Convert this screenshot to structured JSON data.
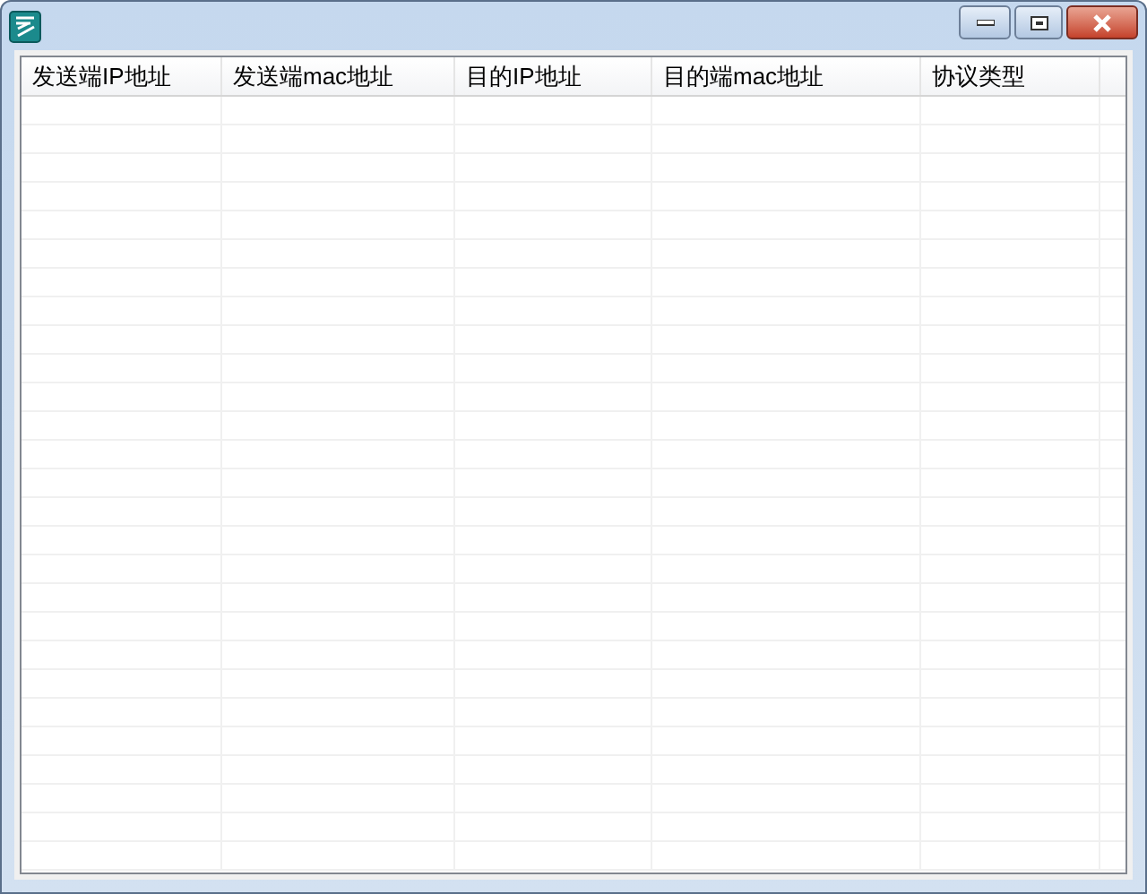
{
  "window": {
    "title_bar_buttons": [
      {
        "kind": "minimize"
      },
      {
        "kind": "maximize"
      },
      {
        "kind": "close"
      }
    ]
  },
  "table": {
    "columns": [
      {
        "label": "发送端IP地址"
      },
      {
        "label": "发送端mac地址"
      },
      {
        "label": "目的IP地址"
      },
      {
        "label": "目的端mac地址"
      },
      {
        "label": "协议类型"
      }
    ]
  }
}
